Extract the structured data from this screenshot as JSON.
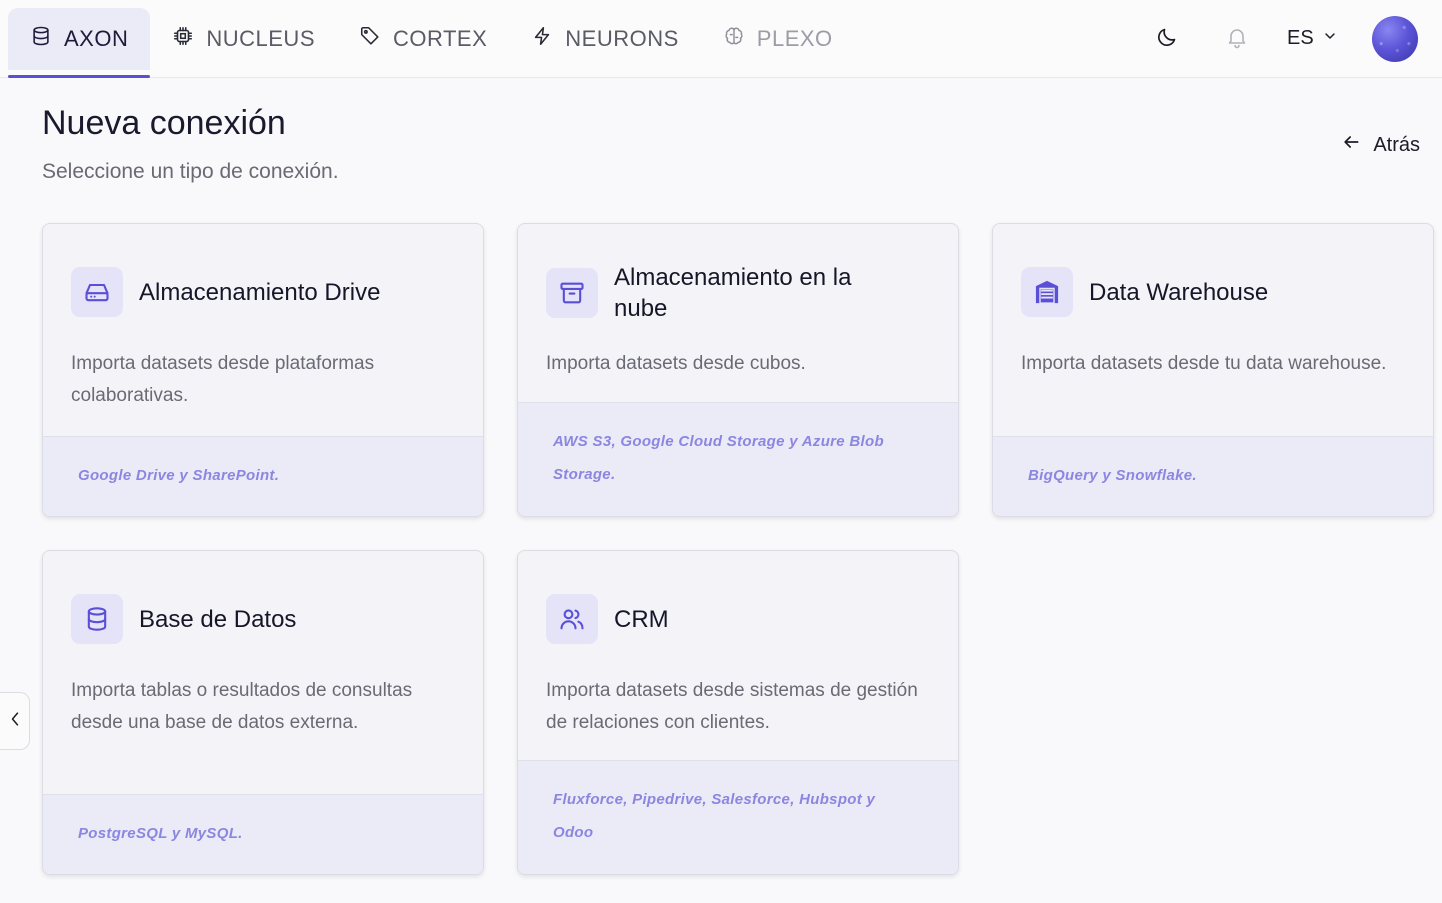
{
  "nav": {
    "tabs": [
      {
        "label": "AXON",
        "icon": "database-icon"
      },
      {
        "label": "NUCLEUS",
        "icon": "cpu-chip-icon"
      },
      {
        "label": "CORTEX",
        "icon": "tag-icon"
      },
      {
        "label": "NEURONS",
        "icon": "lightning-bolt-icon"
      },
      {
        "label": "PLEXO",
        "icon": "brain-icon"
      }
    ],
    "language": "ES"
  },
  "page": {
    "title": "Nueva conexión",
    "subtitle": "Seleccione un tipo de conexión.",
    "back_label": "Atrás"
  },
  "cards": [
    {
      "title": "Almacenamiento Drive",
      "description": "Importa datasets desde plataformas colaborativas.",
      "providers": "Google Drive y SharePoint.",
      "icon": "hard-drive-icon"
    },
    {
      "title": "Almacenamiento en la nube",
      "description": "Importa datasets desde cubos.",
      "providers": "AWS S3, Google Cloud Storage y Azure Blob Storage.",
      "icon": "archive-box-icon"
    },
    {
      "title": "Data Warehouse",
      "description": "Importa datasets desde tu data warehouse.",
      "providers": "BigQuery y Snowflake.",
      "icon": "warehouse-icon"
    },
    {
      "title": "Base de Datos",
      "description": "Importa tablas o resultados de consultas desde una base de datos externa.",
      "providers": "PostgreSQL y MySQL.",
      "icon": "database-icon"
    },
    {
      "title": "CRM",
      "description": "Importa datasets desde sistemas de gestión de relaciones con clientes.",
      "providers": "Fluxforce, Pipedrive, Salesforce, Hubspot y Odoo",
      "icon": "users-icon"
    }
  ],
  "colors": {
    "accent": "#5b4fd6",
    "icon_bg": "#e4e3f8",
    "footer_bg": "#ebebf7",
    "provider_text": "#8b86e0"
  }
}
